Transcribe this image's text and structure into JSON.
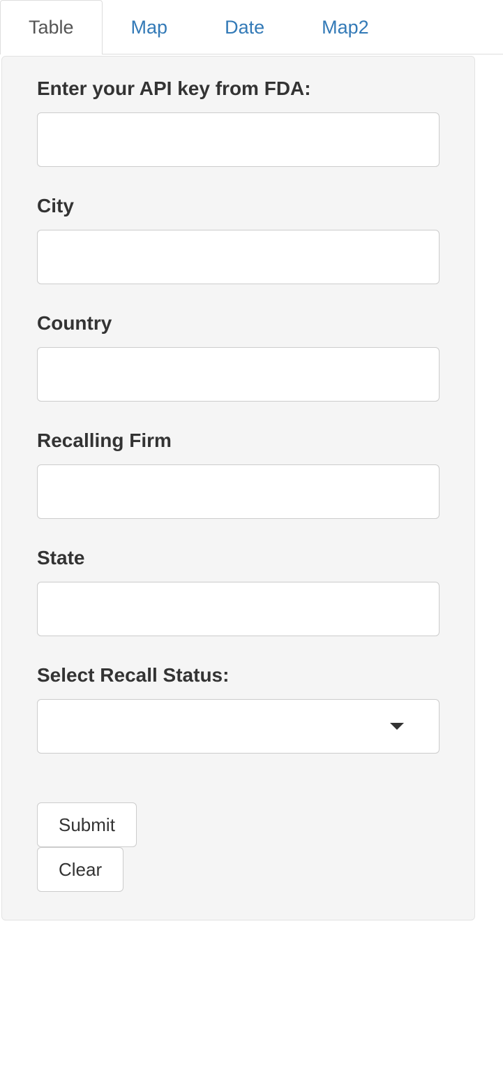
{
  "tabs": [
    {
      "label": "Table",
      "active": true
    },
    {
      "label": "Map",
      "active": false
    },
    {
      "label": "Date",
      "active": false
    },
    {
      "label": "Map2",
      "active": false
    }
  ],
  "form": {
    "api_key": {
      "label": "Enter your API key from FDA:",
      "value": ""
    },
    "city": {
      "label": "City",
      "value": ""
    },
    "country": {
      "label": "Country",
      "value": ""
    },
    "recalling_firm": {
      "label": "Recalling Firm",
      "value": ""
    },
    "state": {
      "label": "State",
      "value": ""
    },
    "recall_status": {
      "label": "Select Recall Status:",
      "value": ""
    }
  },
  "buttons": {
    "submit": "Submit",
    "clear": "Clear"
  }
}
